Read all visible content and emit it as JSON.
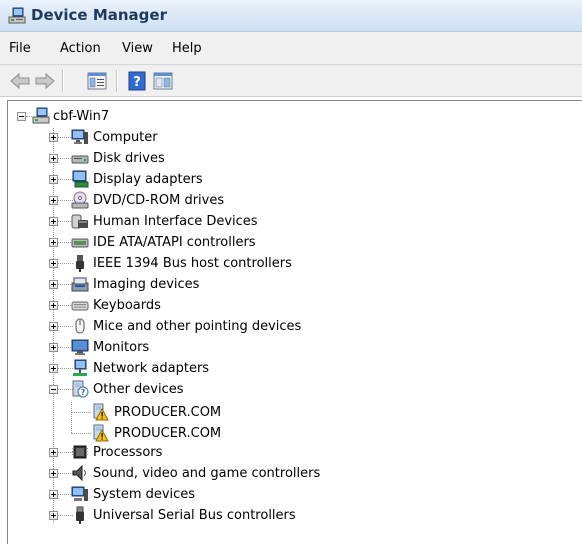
{
  "window": {
    "title": "Device Manager"
  },
  "menu": {
    "file": "File",
    "action": "Action",
    "view": "View",
    "help": "Help"
  },
  "toolbar": {
    "back": "back-arrow-icon",
    "forward": "forward-arrow-icon",
    "properties": "properties-icon",
    "help": "help-icon",
    "show_hide": "show-hide-console-tree-icon"
  },
  "tree": {
    "root": "cbf-Win7",
    "categories": [
      "Computer",
      "Disk drives",
      "Display adapters",
      "DVD/CD-ROM drives",
      "Human Interface Devices",
      "IDE ATA/ATAPI controllers",
      "IEEE 1394 Bus host controllers",
      "Imaging devices",
      "Keyboards",
      "Mice and other pointing devices",
      "Monitors",
      "Network adapters",
      "Other devices",
      "Processors",
      "Sound, video and game controllers",
      "System devices",
      "Universal Serial Bus controllers"
    ],
    "other_devices_children": [
      "PRODUCER.COM",
      "PRODUCER.COM"
    ]
  }
}
